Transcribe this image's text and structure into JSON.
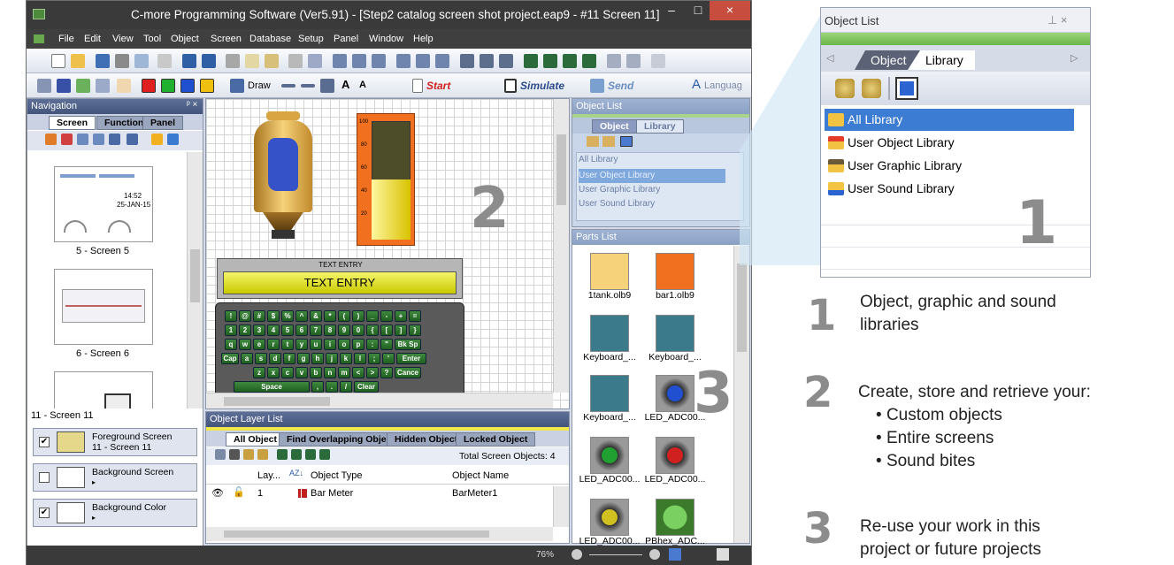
{
  "window": {
    "title": "C-more Programming Software (Ver5.91) - [Step2 catalog screen shot project.eap9 - #11 Screen 11]",
    "controls": [
      "–",
      "□",
      "×"
    ]
  },
  "menu": [
    "File",
    "Edit",
    "View",
    "Tool",
    "Object",
    "Screen",
    "Database",
    "Setup",
    "Panel",
    "Window",
    "Help"
  ],
  "toolbar2": {
    "draw": "Draw",
    "start": "Start",
    "simulate": "Simulate",
    "send": "Send",
    "language": "Languag"
  },
  "navigation": {
    "title": "Navigation",
    "tabs": [
      "Screen",
      "Function",
      "Panel"
    ],
    "thumbnails": [
      {
        "caption": "5 - Screen 5",
        "time": "14:52",
        "date": "25-JAN-15"
      },
      {
        "caption": "6 - Screen 6"
      },
      {
        "caption": ""
      }
    ],
    "current": "11 - Screen 11",
    "layers": [
      {
        "label": "Foreground Screen",
        "sub": "11 - Screen 11",
        "checked": true
      },
      {
        "label": "Background Screen",
        "sub": "▸",
        "checked": false
      },
      {
        "label": "Background Color",
        "sub": "▸",
        "checked": true
      }
    ]
  },
  "canvas": {
    "text_entry_label": "TEXT ENTRY",
    "text_entry_value": "TEXT ENTRY",
    "bar_ticks": [
      "100",
      "80",
      "60",
      "40",
      "20"
    ],
    "callout": "2",
    "keyboard": [
      [
        "!",
        "@",
        "#",
        "$",
        "%",
        "^",
        "&",
        "*",
        "(",
        ")",
        "_",
        "-",
        "+",
        "="
      ],
      [
        "1",
        "2",
        "3",
        "4",
        "5",
        "6",
        "7",
        "8",
        "9",
        "0",
        "{",
        "[",
        "]",
        "}"
      ],
      [
        "q",
        "w",
        "e",
        "r",
        "t",
        "y",
        "u",
        "i",
        "o",
        "p",
        ":",
        "\"",
        "Bk Sp"
      ],
      [
        "Cap",
        "a",
        "s",
        "d",
        "f",
        "g",
        "h",
        "j",
        "k",
        "l",
        ";",
        "'",
        "Enter"
      ],
      [
        "z",
        "x",
        "c",
        "v",
        "b",
        "n",
        "m",
        "<",
        ">",
        "?",
        "Cance"
      ],
      [
        "Space",
        ",",
        ".",
        "/",
        "Clear"
      ]
    ]
  },
  "object_list_small": {
    "title": "Object List",
    "tabs": [
      "Object",
      "Library"
    ],
    "items": [
      "All Library",
      "User Object Library",
      "User Graphic Library",
      "User Sound Library"
    ]
  },
  "parts_list": {
    "title": "Parts List",
    "items": [
      "1tank.olb9",
      "bar1.olb9",
      "Keyboard_...",
      "Keyboard_...",
      "Keyboard_...",
      "LED_ADC00...",
      "LED_ADC00...",
      "LED_ADC00...",
      "LED_ADC00...",
      "PBhex_ADC..."
    ],
    "callout": "3"
  },
  "layer_list": {
    "title": "Object Layer List",
    "tabs": [
      "All Object",
      "Find Overlapping Object",
      "Hidden Object",
      "Locked Object"
    ],
    "total": "Total Screen Objects: 4",
    "columns": [
      "Lay...",
      "Object Type",
      "Object Name"
    ],
    "rows": [
      {
        "layer": "1",
        "type": "Bar Meter",
        "name": "BarMeter1"
      }
    ]
  },
  "statusbar": {
    "zoom": "76%"
  },
  "library_zoom": {
    "title": "Object List",
    "tabs": [
      "Object",
      "Library"
    ],
    "items": [
      "All Library",
      "User Object Library",
      "User Graphic Library",
      "User Sound Library"
    ],
    "callout": "1"
  },
  "features": [
    {
      "num": "1",
      "text": "Object, graphic and sound\nlibraries",
      "bullets": []
    },
    {
      "num": "2",
      "text": "Create, store and retrieve your:",
      "bullets": [
        "Custom objects",
        "Entire screens",
        "Sound bites"
      ]
    },
    {
      "num": "3",
      "text": "Re-use your work in this\nproject or future projects",
      "bullets": []
    }
  ]
}
